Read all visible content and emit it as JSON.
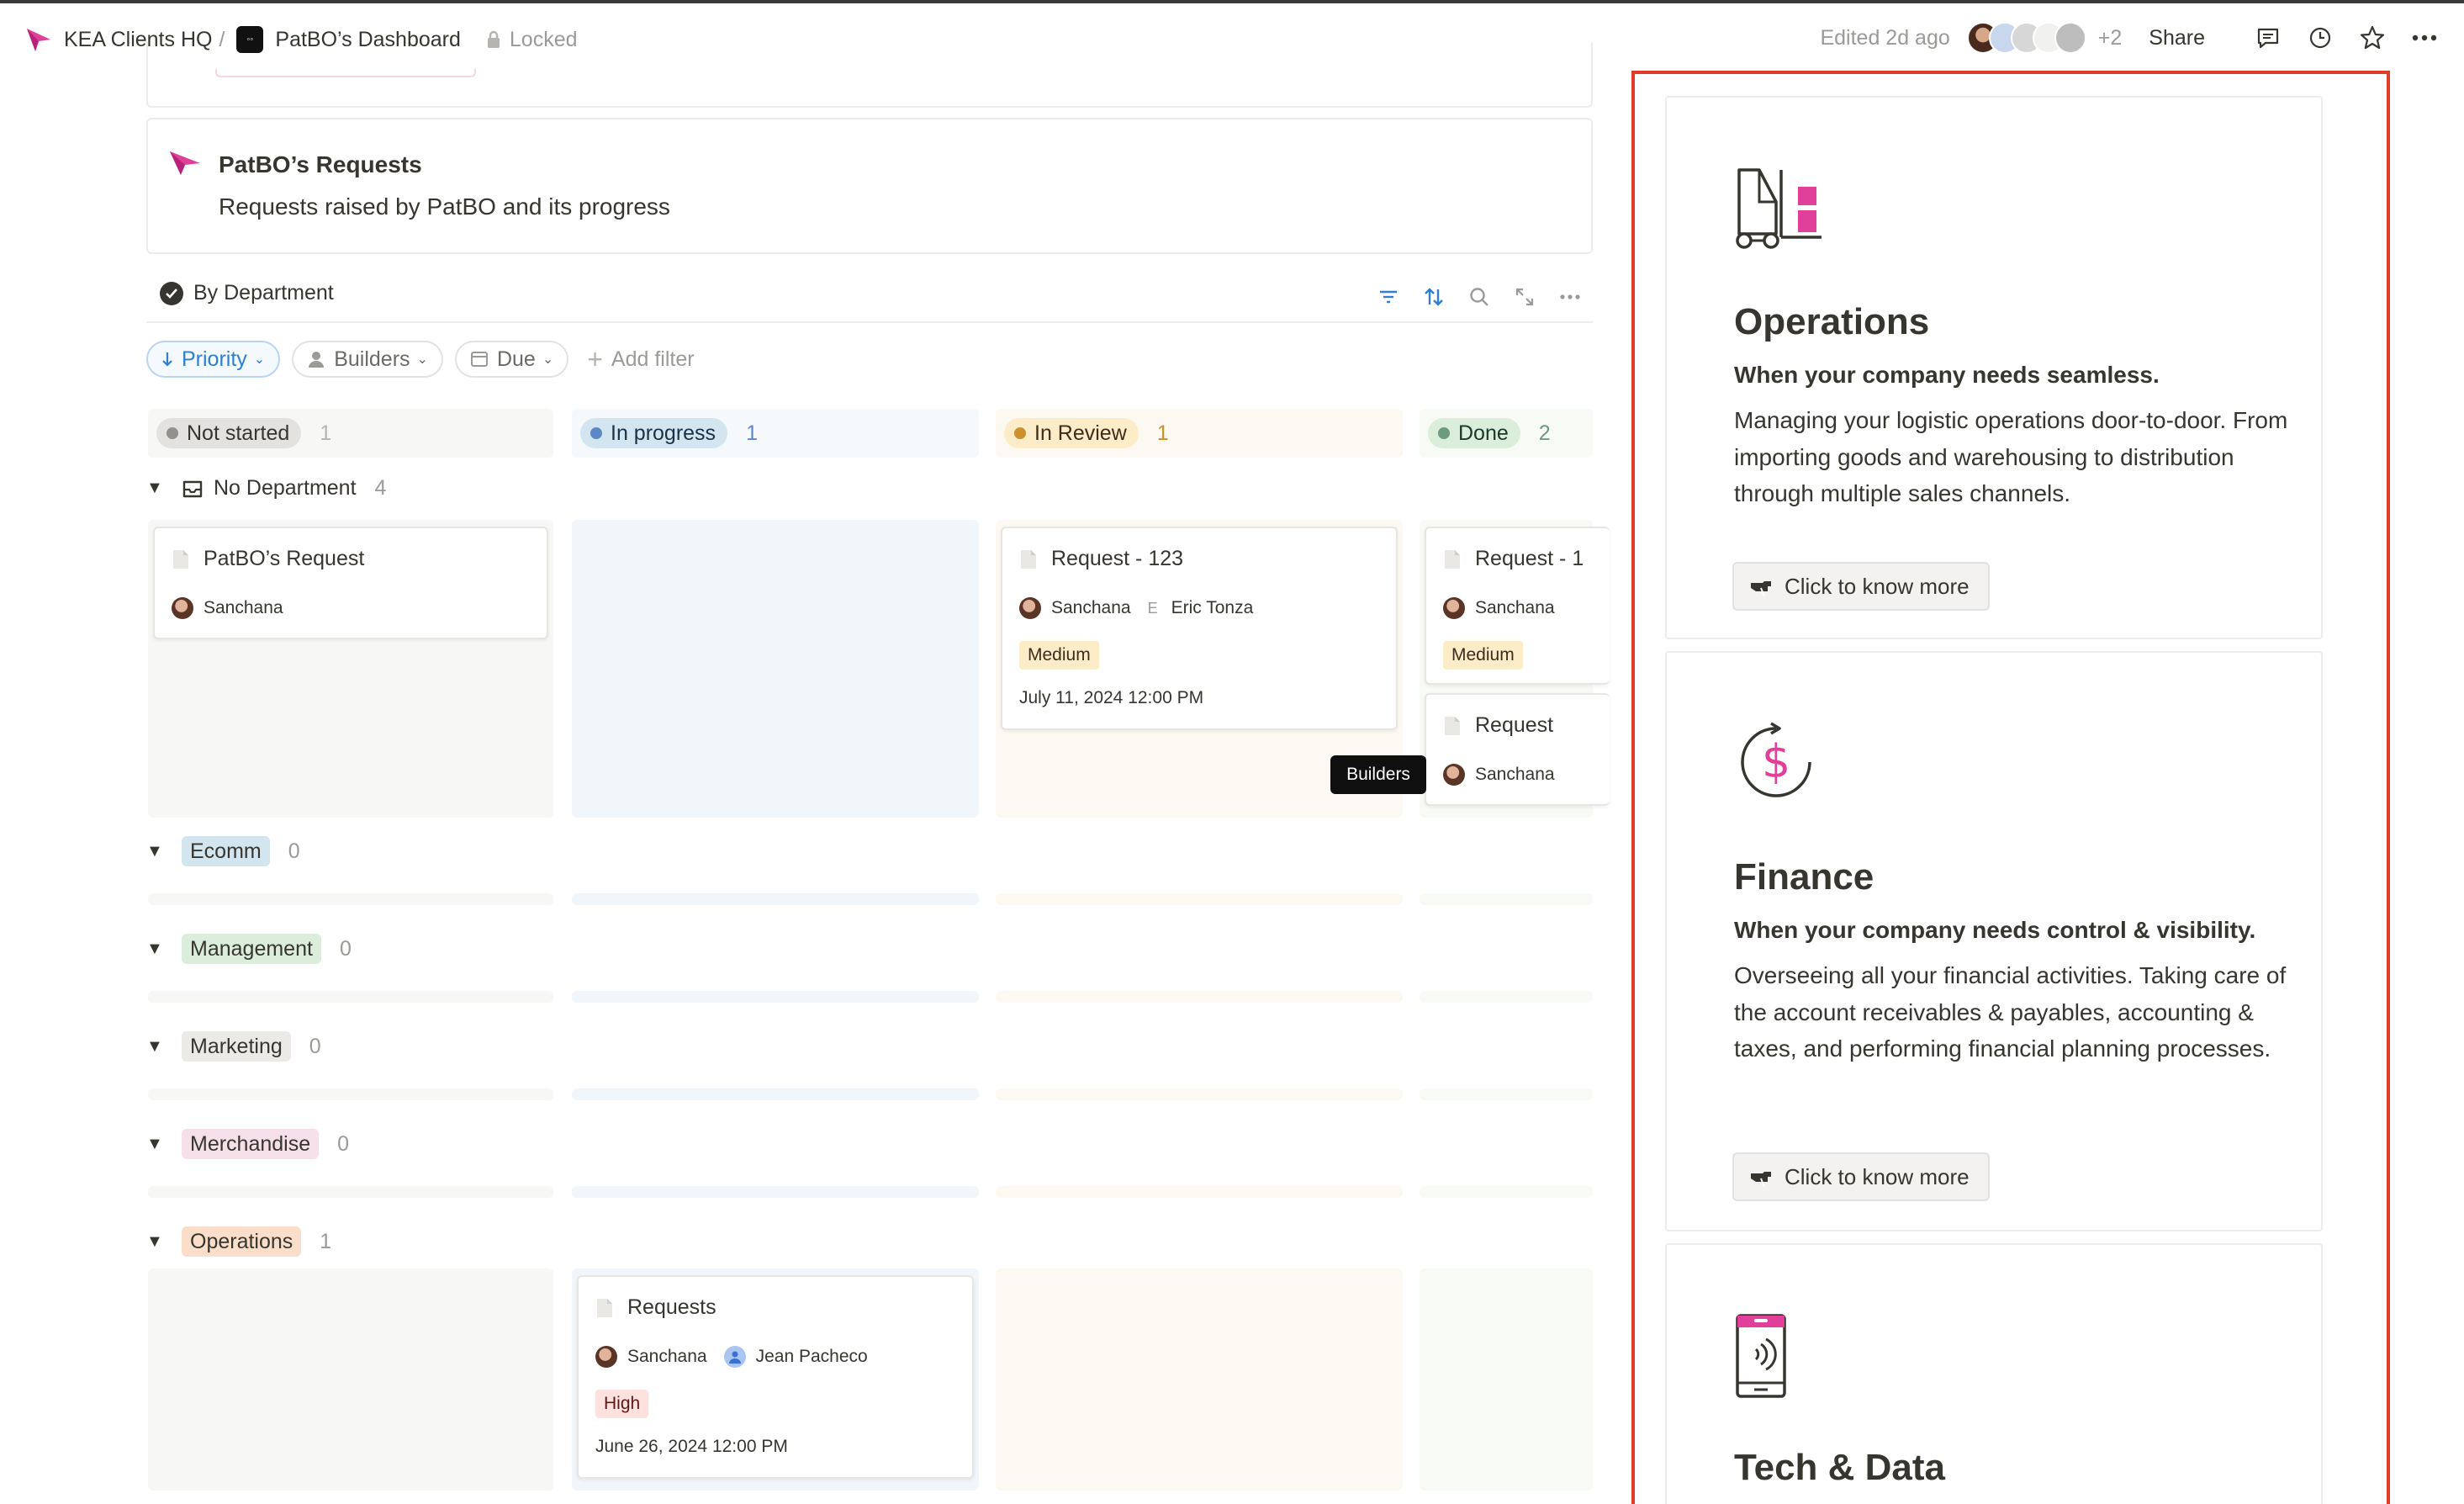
{
  "breadcrumb": {
    "workspace": "KEA Clients HQ",
    "separator": "/",
    "page": "PatBO’s Dashboard",
    "lock_label": "Locked"
  },
  "topbar": {
    "edited": "Edited 2d ago",
    "more_collaborators": "+2",
    "share_label": "Share",
    "icons": [
      "comments-icon",
      "history-icon",
      "favorite-star-icon",
      "more-icon"
    ]
  },
  "callout": {
    "title": "PatBO’s Requests",
    "subtitle": "Requests raised by PatBO and its progress"
  },
  "view": {
    "name": "By Department",
    "tools": [
      "filter-icon",
      "sort-icon",
      "search-icon",
      "expand-icon",
      "more-icon"
    ]
  },
  "filters": {
    "priority": "Priority",
    "builders": "Builders",
    "due": "Due",
    "add_filter": "Add filter"
  },
  "columns": [
    {
      "label": "Not started",
      "count": "1"
    },
    {
      "label": "In progress",
      "count": "1"
    },
    {
      "label": "In Review",
      "count": "1"
    },
    {
      "label": "Done",
      "count": "2"
    }
  ],
  "groups": [
    {
      "label": "No Department",
      "count": "4"
    },
    {
      "label": "Ecomm",
      "count": "0"
    },
    {
      "label": "Management",
      "count": "0"
    },
    {
      "label": "Marketing",
      "count": "0"
    },
    {
      "label": "Merchandise",
      "count": "0"
    },
    {
      "label": "Operations",
      "count": "1"
    }
  ],
  "cards": {
    "patbo_request": {
      "title": "PatBO’s Request",
      "person": "Sanchana"
    },
    "request_123": {
      "title": "Request - 123",
      "person": "Sanchana",
      "initial": "E",
      "person2": "Eric Tonza",
      "priority": "Medium",
      "date": "July 11, 2024 12:00 PM"
    },
    "done_1": {
      "title": "Request - 1",
      "person": "Sanchana",
      "priority": "Medium"
    },
    "done_2": {
      "title": "Request",
      "person": "Sanchana"
    },
    "ops_requests": {
      "title": "Requests",
      "person": "Sanchana",
      "person2": "Jean Pacheco",
      "priority": "High",
      "date": "June 26, 2024 12:00 PM"
    }
  },
  "tooltip": "Builders",
  "services": [
    {
      "icon": "forklift-icon",
      "title": "Operations",
      "subtitle": "When your company needs seamless.",
      "body": "Managing your logistic operations door-to-door. From importing goods and warehousing to distribution through multiple sales channels.",
      "button": "Click to know more"
    },
    {
      "icon": "dollar-cycle-icon",
      "title": "Finance",
      "subtitle": "When your company needs control & visibility.",
      "body": "Overseeing all your financial activities. Taking care of the account receivables & payables, accounting & taxes, and performing financial planning processes.",
      "button": "Click to know more"
    },
    {
      "icon": "mobile-nfc-icon",
      "title": "Tech & Data"
    }
  ],
  "colors": {
    "accent_pink": "#e0409a",
    "highlight_border": "#e03a2b",
    "not_started": "#e3e2e0",
    "in_progress": "#d3e5ef",
    "in_review": "#fdecc8",
    "done": "#dbeddb",
    "ecomm": "#d3e5ef",
    "management": "#dbeddb",
    "marketing": "#e3e2e0",
    "merchandise": "#f5e0e9",
    "operations": "#fadec9",
    "medium": "#fdecc8",
    "high": "#ffe2dd"
  }
}
